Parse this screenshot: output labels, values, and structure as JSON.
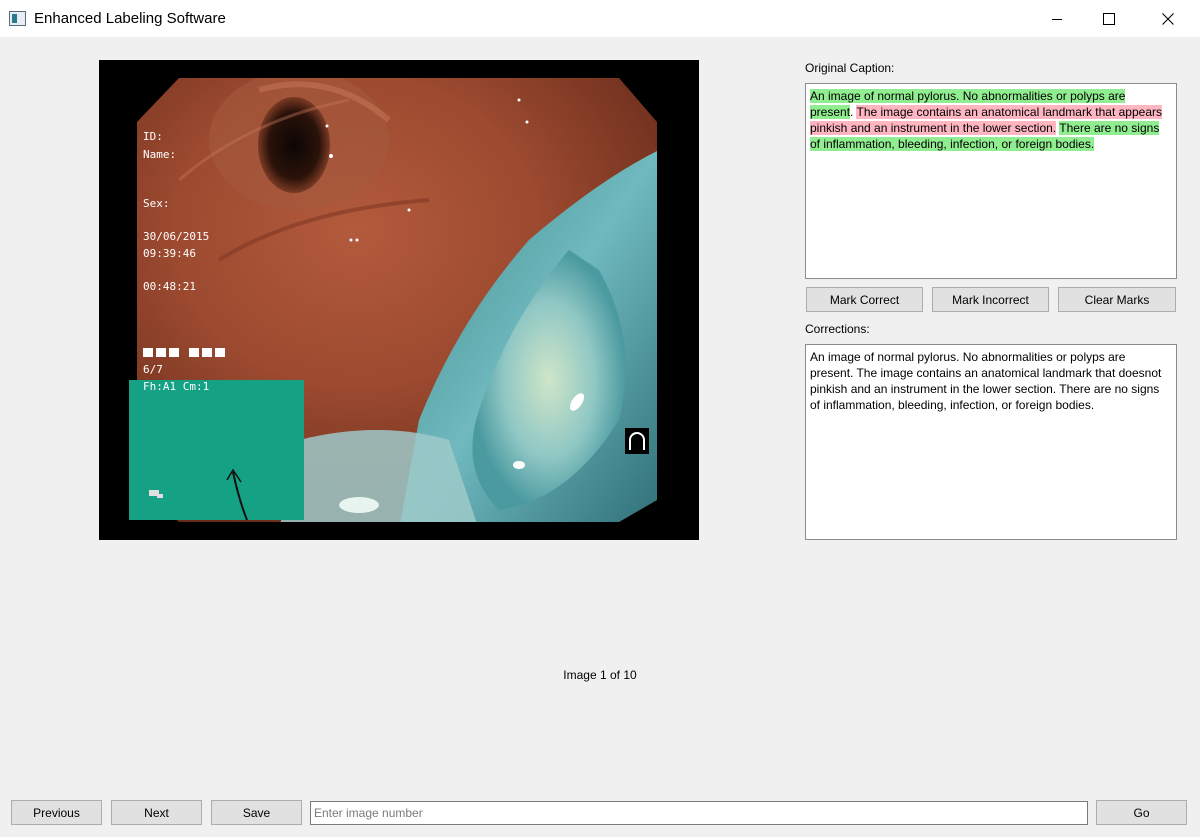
{
  "window": {
    "title": "Enhanced Labeling Software"
  },
  "image_overlay": {
    "id_label": "ID:",
    "name_label": "Name:",
    "sex_label": "Sex:",
    "date": "30/06/2015",
    "time": "09:39:46",
    "elapsed": "00:48:21",
    "counter": "6/7",
    "settings": "Fh:A1  Cm:1"
  },
  "original_caption": {
    "label": "Original Caption:",
    "segments": [
      {
        "text": "An image of normal pylorus. No abnormalities or polyps are present",
        "mark": "correct"
      },
      {
        "text": ". ",
        "mark": "none"
      },
      {
        "text": "The image contains an anatomical landmark that appears pinkish and an instrument in the lower section.",
        "mark": "incorrect"
      },
      {
        "text": " ",
        "mark": "none"
      },
      {
        "text": "There are no signs of inflammation, bleeding, infection, or foreign bodies.",
        "mark": "correct"
      }
    ]
  },
  "marks": {
    "correct_label": "Mark Correct",
    "incorrect_label": "Mark Incorrect",
    "clear_label": "Clear Marks"
  },
  "corrections": {
    "label": "Corrections:",
    "text": "An image of normal pylorus. No abnormalities or polyps are present. The image contains an anatomical landmark that doesnot pinkish and an instrument in the lower section. There are no signs of inflammation, bleeding, infection, or foreign bodies."
  },
  "status": {
    "text": "Image 1 of 10"
  },
  "navigation": {
    "previous_label": "Previous",
    "next_label": "Next",
    "save_label": "Save",
    "jump_placeholder": "Enter image number",
    "go_label": "Go"
  },
  "colors": {
    "correct_highlight": "#90ee90",
    "incorrect_highlight": "#ffb6c1"
  }
}
